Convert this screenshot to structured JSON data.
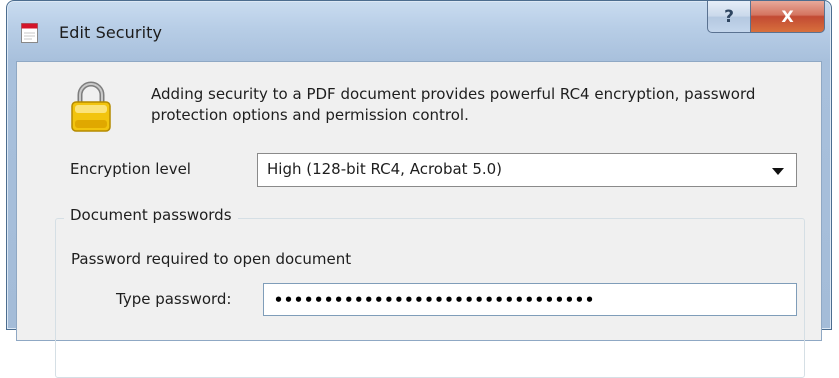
{
  "window": {
    "title": "Edit Security",
    "help_glyph": "?",
    "close_glyph": "X"
  },
  "intro": {
    "text": "Adding security to a PDF document provides powerful RC4 encryption, password protection options and permission control.",
    "icon": "lock-icon"
  },
  "encryption": {
    "label": "Encryption level",
    "selected": "High (128-bit RC4, Acrobat 5.0)"
  },
  "passwords": {
    "group_title": "Document passwords",
    "open_label": "Password required to open document",
    "type_label": "Type password:",
    "value": "••••••••••••••••••••••••••••••••"
  },
  "colors": {
    "title_bar": "#b7cde6",
    "client_bg": "#f0f0f0",
    "close_button": "#c24a33",
    "lock_body": "#f2c40e"
  }
}
